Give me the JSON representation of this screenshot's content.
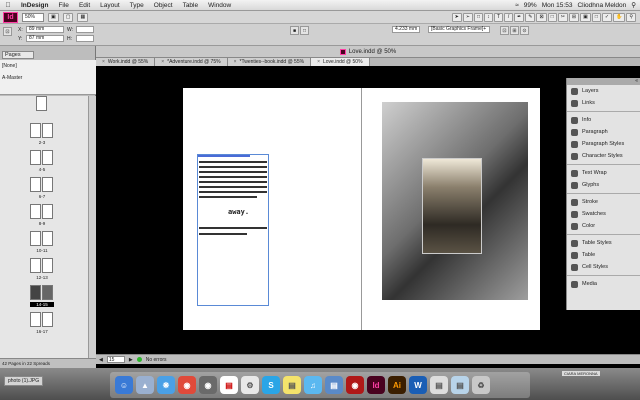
{
  "menubar": {
    "app_name": "InDesign",
    "items": [
      "File",
      "Edit",
      "Layout",
      "Type",
      "Object",
      "Table",
      "Window"
    ],
    "battery": "99%",
    "clock": "Mon 15:53",
    "user": "Cliodhna Meldon"
  },
  "controlbar": {
    "zoom": "50%"
  },
  "propbar": {
    "x": "89 mm",
    "y": "87 mm",
    "width_value": "4.233 mm",
    "style_select": "[Basic Graphics Frame]+"
  },
  "window_title": "Love.indd @ 50%",
  "tabs": [
    {
      "label": "Work.indd @ 55%"
    },
    {
      "label": "*Adventure.indd @ 75%"
    },
    {
      "label": "*Twenties--book.indd @ 55%"
    },
    {
      "label": "Love.indd @ 50%"
    }
  ],
  "pages_panel": {
    "tab_label": "Pages",
    "none_master": "[None]",
    "a_master": "A-Master",
    "spreads": [
      "2-3",
      "4-5",
      "6-7",
      "8-9",
      "10-11",
      "12-13",
      "14-15",
      "16-17"
    ],
    "selected_spread": "14-15",
    "footer": "42 Pages in 22 Spreads"
  },
  "canvas": {
    "text_word": "away."
  },
  "right_panel": {
    "groups": [
      [
        "Layers",
        "Links"
      ],
      [
        "Info",
        "Paragraph",
        "Paragraph Styles",
        "Character Styles"
      ],
      [
        "Text Wrap",
        "Glyphs"
      ],
      [
        "Stroke",
        "Swatches",
        "Color"
      ],
      [
        "Table Styles",
        "Table",
        "Cell Styles"
      ],
      [
        "Media"
      ]
    ]
  },
  "status": {
    "page": "15",
    "errors": "No errors"
  },
  "dock": {
    "file_label": "photo (1).JPG",
    "tag": "CIARA MERONNA"
  }
}
